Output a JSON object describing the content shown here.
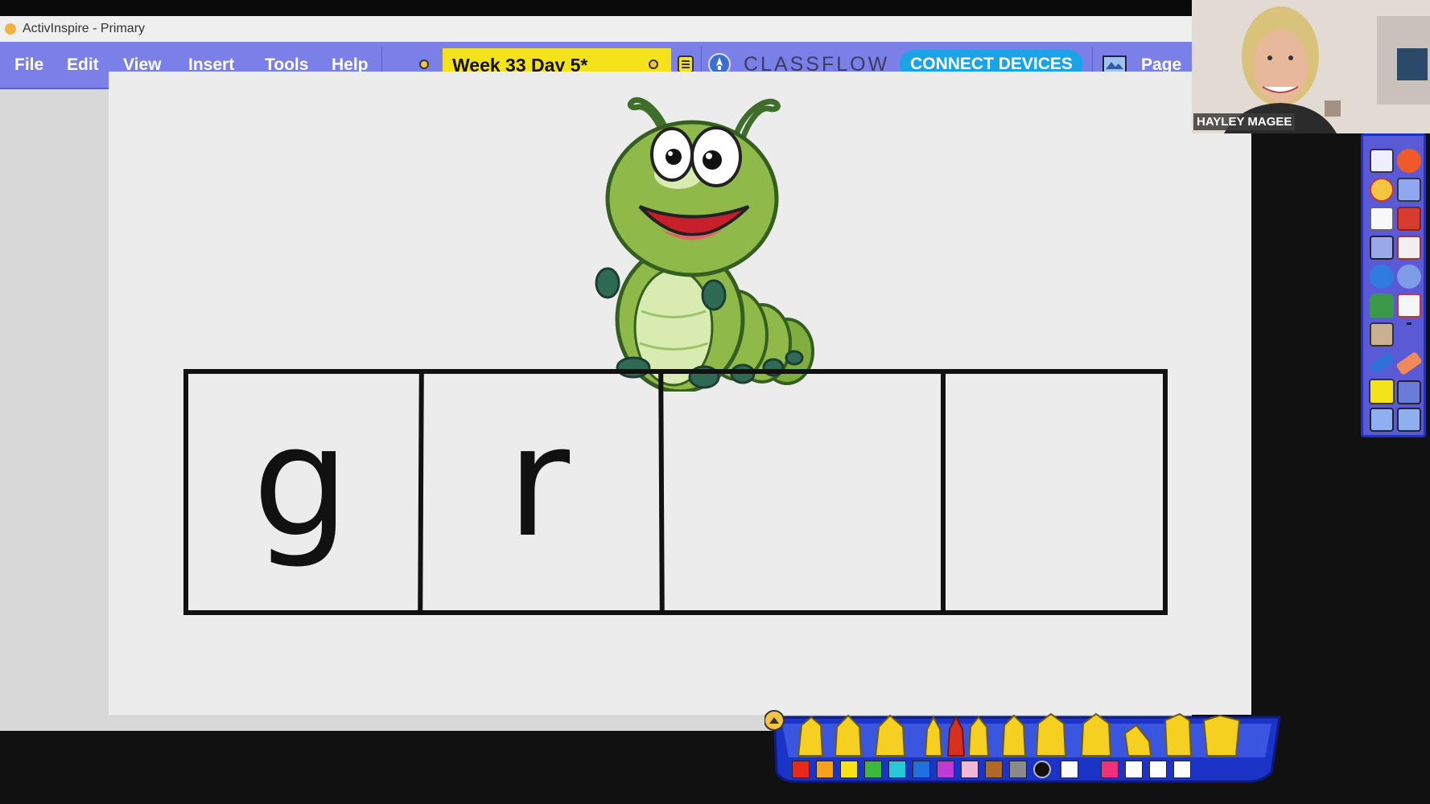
{
  "window": {
    "title": "ActivInspire - Primary"
  },
  "menu": [
    "File",
    "Edit",
    "View",
    "Insert",
    "Tools",
    "Help"
  ],
  "document": {
    "title": "Week 33 Day 5*"
  },
  "brand": {
    "classflow": "CLASSFLOW",
    "connect": "CONNECT DEVICES",
    "page": "Page"
  },
  "webcam": {
    "name": "HAYLEY MAGEE"
  },
  "flipchart": {
    "letters": [
      "g",
      "r",
      "",
      ""
    ]
  },
  "colors": {
    "menubar": "#7b80e8",
    "doc_tab": "#f4e21a",
    "connect_button": "#1aa3e6",
    "caterpillar_green": "#8fba4a",
    "palette": [
      "#e8281b",
      "#f5a11a",
      "#f5e21a",
      "#3cb83c",
      "#27c8d8",
      "#1f6fe0",
      "#c03ad8",
      "#f2b6d8",
      "#b06a24",
      "#8a8a8a",
      "#111111",
      "#ffffff",
      "#f0307a",
      "#ffffff",
      "#ffffff",
      "#ffffff"
    ]
  },
  "toolbox_icons": [
    "page-browser-icon",
    "pen-red-icon",
    "circle-shape-icon",
    "screen-icon",
    "document-icon",
    "eraser-red-icon",
    "grid-icon",
    "camera-icon",
    "undo-icon",
    "redo-icon",
    "bottle-icon",
    "delete-icon",
    "fill-icon",
    "text-icon",
    "marker-icon",
    "eraser-icon",
    "highlighter-icon",
    "select-icon",
    "previous-page-icon",
    "next-page-icon"
  ]
}
